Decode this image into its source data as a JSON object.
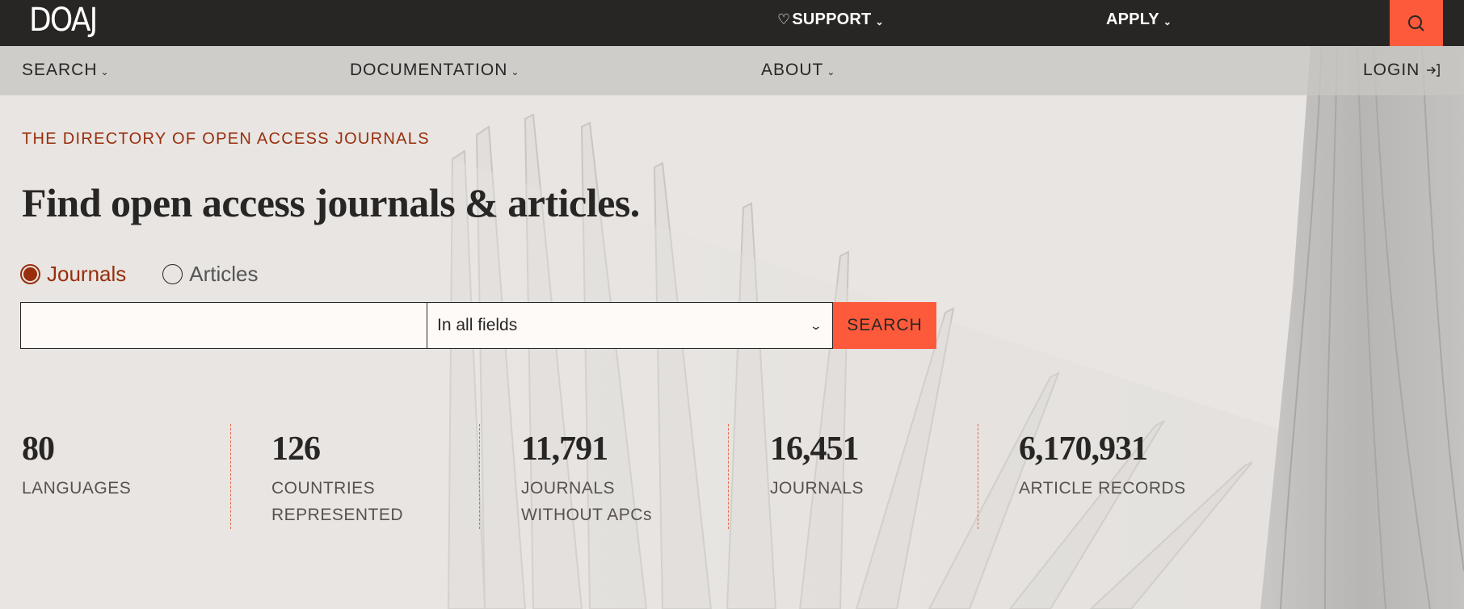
{
  "topbar": {
    "logo": "DOAJ",
    "support": "SUPPORT",
    "apply": "APPLY",
    "search_icon": "search-icon",
    "heart_icon": "heart-icon"
  },
  "nav": {
    "search": "SEARCH",
    "documentation": "DOCUMENTATION",
    "about": "ABOUT",
    "login": "LOGIN",
    "login_icon": "login-arrow-icon"
  },
  "hero": {
    "tagline": "THE DIRECTORY OF OPEN ACCESS JOURNALS",
    "headline": "Find open access journals & articles."
  },
  "search": {
    "options": [
      {
        "label": "Journals",
        "checked": true
      },
      {
        "label": "Articles",
        "checked": false
      }
    ],
    "input_value": "",
    "field_selected": "In all fields",
    "button_label": "SEARCH"
  },
  "stats": [
    {
      "value": "80",
      "label_lines": [
        "LANGUAGES"
      ]
    },
    {
      "value": "126",
      "label_lines": [
        "COUNTRIES",
        "REPRESENTED"
      ]
    },
    {
      "value": "11,791",
      "label_lines": [
        "JOURNALS",
        "WITHOUT APCs"
      ]
    },
    {
      "value": "16,451",
      "label_lines": [
        "JOURNALS"
      ]
    },
    {
      "value": "6,170,931",
      "label_lines": [
        "ARTICLE RECORDS"
      ]
    }
  ],
  "colors": {
    "accent": "#fd5a3b",
    "brand_dark": "#282624",
    "brand_red": "#982e0c"
  }
}
